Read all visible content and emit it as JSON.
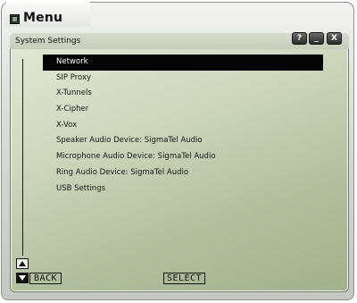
{
  "window": {
    "title": "Menu"
  },
  "panel": {
    "title": "System Settings",
    "buttons": {
      "help": "?",
      "minimize": "_",
      "close": "X"
    }
  },
  "menu": {
    "items": [
      {
        "label": "Network",
        "selected": true
      },
      {
        "label": "SIP Proxy"
      },
      {
        "label": "X-Tunnels"
      },
      {
        "label": "X-Cipher"
      },
      {
        "label": "X-Vox"
      },
      {
        "label": "Speaker Audio Device: SigmaTel Audio"
      },
      {
        "label": "Microphone Audio Device: SigmaTel Audio"
      },
      {
        "label": "Ring Audio Device: SigmaTel Audio"
      },
      {
        "label": "USB Settings"
      }
    ]
  },
  "footer": {
    "back_label": "BACK",
    "select_label": "SELECT"
  },
  "icons": {
    "app": "menu-app-icon",
    "scroll_up": "arrow-up-icon",
    "scroll_down": "arrow-down-icon"
  }
}
